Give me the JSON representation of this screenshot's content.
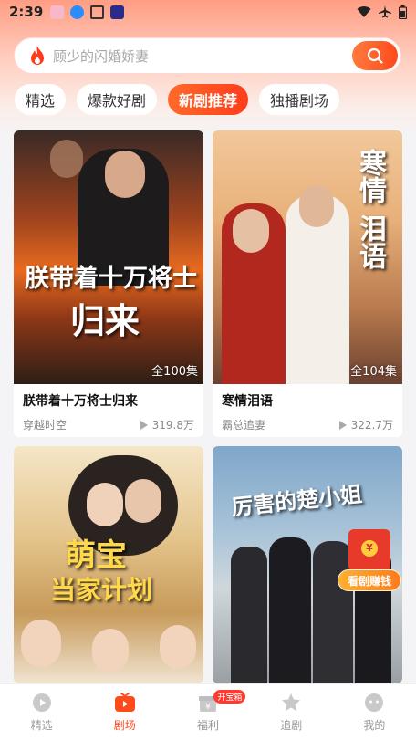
{
  "status_bar": {
    "time": "2:39"
  },
  "search": {
    "placeholder": "顾少的闪婚娇妻",
    "button_icon": "search-icon"
  },
  "tabs": [
    {
      "label": "精选",
      "active": false
    },
    {
      "label": "爆款好剧",
      "active": false
    },
    {
      "label": "新剧推荐",
      "active": true
    },
    {
      "label": "独播剧场",
      "active": false
    }
  ],
  "cards": [
    {
      "poster_text_1": "朕带着十万将士",
      "poster_text_2": "归来",
      "count": "全100集",
      "title": "朕带着十万将士归来",
      "genre": "穿越时空",
      "views": "319.8万"
    },
    {
      "poster_text_1": "寒情",
      "poster_text_2": "泪语",
      "count": "全104集",
      "title": "寒情泪语",
      "genre": "霸总追妻",
      "views": "322.7万"
    },
    {
      "poster_text_1": "萌宝",
      "poster_text_2": "当家计划",
      "count": "",
      "title": "",
      "genre": "",
      "views": ""
    },
    {
      "poster_text_1": "厉害的楚小姐",
      "poster_text_2": "",
      "count": "",
      "title": "",
      "genre": "",
      "views": ""
    }
  ],
  "reward": {
    "coin_symbol": "¥",
    "label": "看剧赚钱"
  },
  "nav": [
    {
      "label": "精选",
      "icon": "play-circle-icon",
      "active": false
    },
    {
      "label": "剧场",
      "icon": "theater-icon",
      "active": true
    },
    {
      "label": "福利",
      "icon": "gift-icon",
      "active": false,
      "badge": "开宝箱"
    },
    {
      "label": "追剧",
      "icon": "star-icon",
      "active": false
    },
    {
      "label": "我的",
      "icon": "profile-icon",
      "active": false
    }
  ],
  "colors": {
    "accent": "#ff4a1c",
    "tab_active": "#ff3d1b"
  }
}
